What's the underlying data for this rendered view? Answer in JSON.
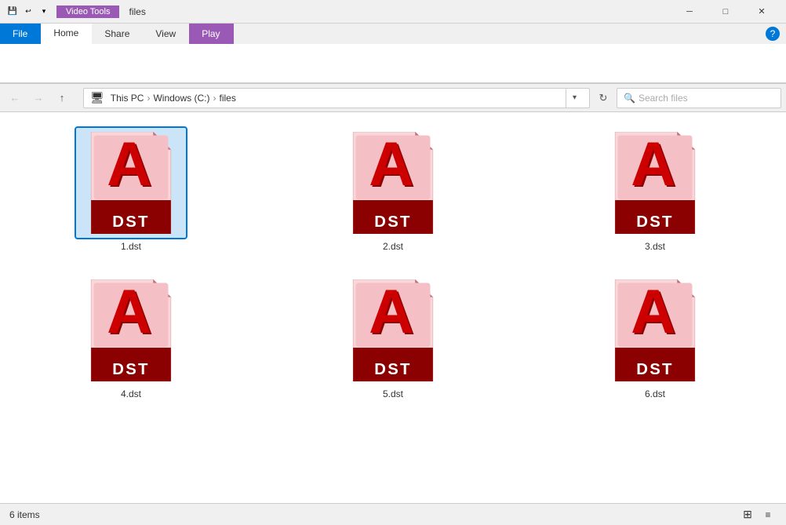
{
  "titlebar": {
    "video_tools_label": "Video Tools",
    "title": "files",
    "minimize_label": "─",
    "maximize_label": "□",
    "close_label": "✕"
  },
  "ribbon": {
    "tabs": [
      "File",
      "Home",
      "Share",
      "View",
      "Play"
    ],
    "active_tab": "Home"
  },
  "navbar": {
    "back_icon": "←",
    "forward_icon": "→",
    "up_icon": "↑",
    "breadcrumb": [
      "This PC",
      "Windows (C:)",
      "files"
    ],
    "refresh_icon": "↻",
    "search_placeholder": "Search files",
    "search_label": "Search"
  },
  "files": [
    {
      "name": "1.dst",
      "selected": true
    },
    {
      "name": "2.dst",
      "selected": false
    },
    {
      "name": "3.dst",
      "selected": false
    },
    {
      "name": "4.dst",
      "selected": false
    },
    {
      "name": "5.dst",
      "selected": false
    },
    {
      "name": "6.dst",
      "selected": false
    }
  ],
  "statusbar": {
    "item_count": "6 items",
    "grid_view_icon": "⊞",
    "list_view_icon": "≡"
  }
}
